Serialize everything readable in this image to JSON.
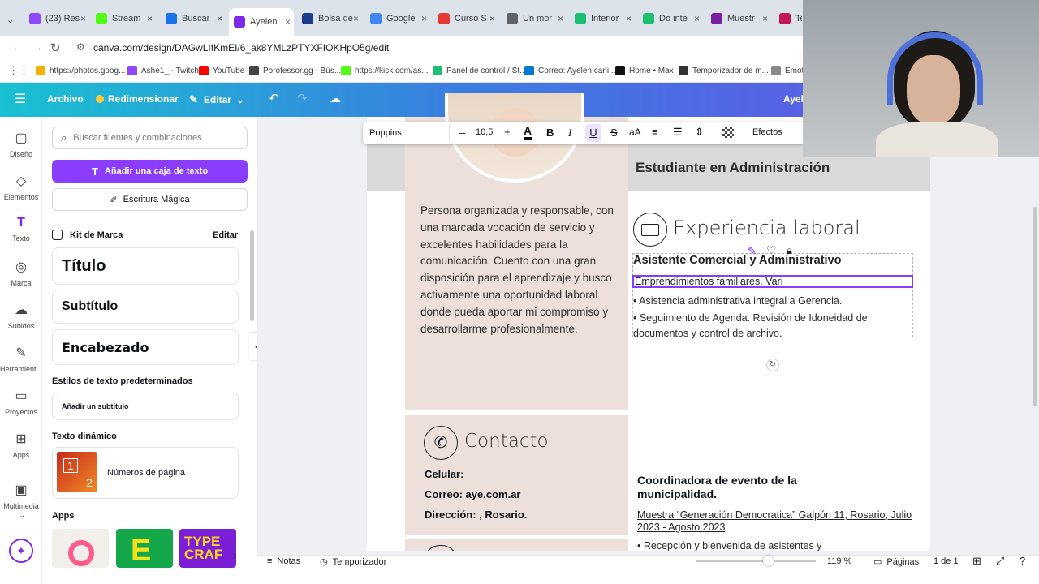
{
  "browser": {
    "tabs": [
      {
        "label": "(23) Res",
        "color": "#9146ff"
      },
      {
        "label": "Stream",
        "color": "#53fc18"
      },
      {
        "label": "Buscar",
        "color": "#1a73e8"
      },
      {
        "label": "Ayelen",
        "color": "#7d2ae8"
      },
      {
        "label": "Bolsa de",
        "color": "#1e3a8a"
      },
      {
        "label": "Google",
        "color": "#4285f4"
      },
      {
        "label": "Curso S",
        "color": "#e53935"
      },
      {
        "label": "Un mor",
        "color": "#5f6368"
      },
      {
        "label": "Interior",
        "color": "#1dbf73"
      },
      {
        "label": "Do inte",
        "color": "#1dbf73"
      },
      {
        "label": "Muestr",
        "color": "#7b1fa2"
      },
      {
        "label": "Tec",
        "color": "#c2185b"
      }
    ],
    "url": "canva.com/design/DAGwLIfKmEI/6_ak8YMLzPTYXFIOKHpO5g/edit",
    "bookmarks": [
      "https://photos.goog...",
      "Ashe1_ - Twitch",
      "YouTube",
      "Porofessor.gg - Bús...",
      "https://kick.com/as...",
      "Panel de control / St...",
      "Correo: Ayelen carli...",
      "Home • Max",
      "Temporizador de m...",
      "Emote"
    ]
  },
  "topbar": {
    "archivo": "Archivo",
    "redimensionar": "Redimensionar",
    "editar": "Editar",
    "user": "Ayele"
  },
  "rail": [
    "Diseño",
    "Elementos",
    "Texto",
    "Marca",
    "Subidos",
    "Herramient...",
    "Proyectos",
    "Apps",
    "Multimedia ..."
  ],
  "panel": {
    "search_placeholder": "Buscar fuentes y combinaciones",
    "add_textbox": "Añadir una caja de texto",
    "magic_write": "Escritura Mágica",
    "brand_kit": "Kit de Marca",
    "brand_edit": "Editar",
    "title": "Título",
    "subtitle": "Subtítulo",
    "heading": "Encabezado",
    "default_styles": "Estilos de texto predeterminados",
    "add_subtitle": "Añadir un subtítulo",
    "dynamic_text": "Texto dinámico",
    "page_numbers": "Números de página",
    "apps": "Apps"
  },
  "toolbar": {
    "font": "Poppins",
    "size": "10,5",
    "effects": "Efectos"
  },
  "doc": {
    "role": "Estudiante en Administración",
    "summary": "Persona organizada y responsable, con una marcada vocación de servicio y excelentes habilidades para la comunicación. Cuento con una gran disposición para el aprendizaje y busco activamente una oportunidad laboral donde pueda aportar mi compromiso y desarrollarme profesionalmente.",
    "experience_title": "Experiencia laboral",
    "job1_title": "Asistente Comercial y Administrativo",
    "job1_company": "Emprendimientos familiares. Vari",
    "job1_b1": "• Asistencia administrativa integral a Gerencia.",
    "job1_b2": "• Seguimiento de Agenda. Revisión de Idoneidad de documentos y control de archivo.",
    "contact_title": "Contacto",
    "celular": "Celular:",
    "correo": "Correo: aye.com.ar",
    "direccion": "Dirección: , Rosario.",
    "job2_title": "Coordinadora de evento de la municipalidad.",
    "job2_place": "Muestra “Generación Democratica” Galpón 11, Rosario, Julio 2023 - Agosto 2023",
    "job2_b1": "• Recepción y bienvenida de asistentes y"
  },
  "bottom": {
    "notes": "Notas",
    "timer": "Temporizador",
    "zoom": "119 %",
    "zoom_level": 0.6,
    "pages": "Páginas",
    "page_of": "1 de 1"
  }
}
